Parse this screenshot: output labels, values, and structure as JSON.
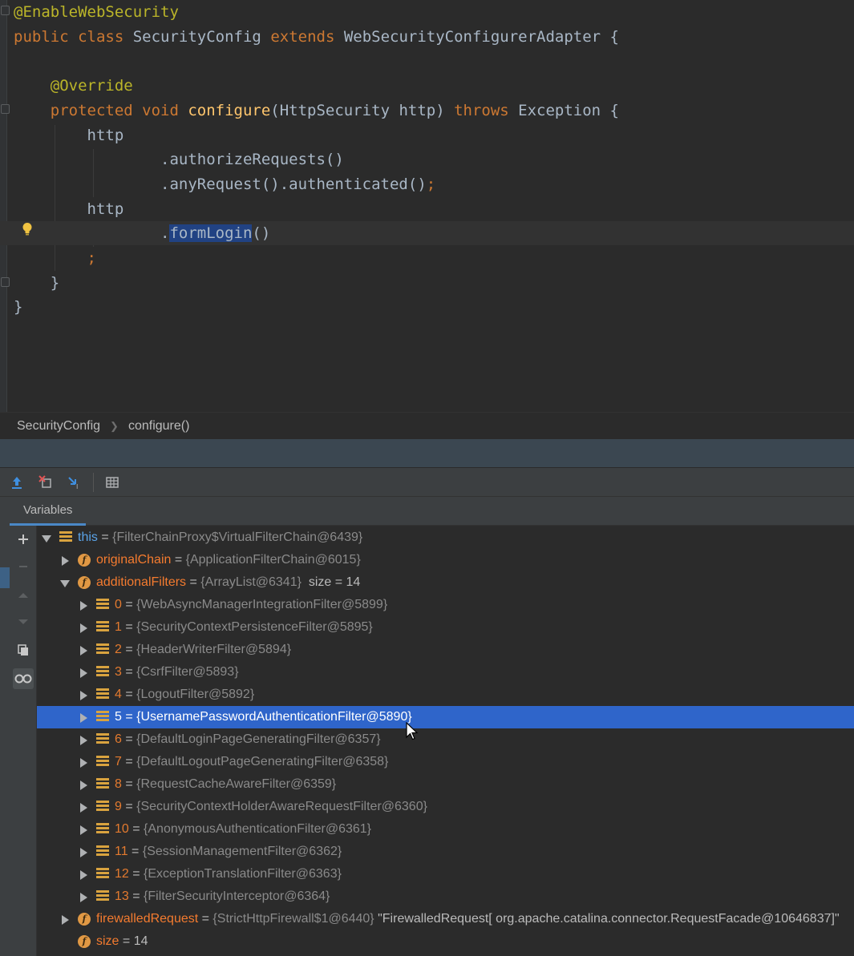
{
  "editor": {
    "lines": [
      [
        {
          "t": "@EnableWebSecurity",
          "c": "a"
        }
      ],
      [
        {
          "t": "public class ",
          "c": "k"
        },
        {
          "t": "SecurityConfig ",
          "c": "n"
        },
        {
          "t": "extends ",
          "c": "k"
        },
        {
          "t": "WebSecurityConfigurerAdapter {",
          "c": "n"
        }
      ],
      [],
      [
        {
          "t": "    @Override",
          "c": "a"
        }
      ],
      [
        {
          "t": "    protected void ",
          "c": "k"
        },
        {
          "t": "configure",
          "c": "f"
        },
        {
          "t": "(HttpSecurity http) ",
          "c": "n"
        },
        {
          "t": "throws ",
          "c": "k"
        },
        {
          "t": "Exception {",
          "c": "n"
        }
      ],
      [
        {
          "t": "        http",
          "c": "n"
        }
      ],
      [
        {
          "t": "                .authorizeRequests()",
          "c": "m"
        }
      ],
      [
        {
          "t": "                .anyRequest().authenticated()",
          "c": "m"
        },
        {
          "t": ";",
          "c": "k"
        }
      ],
      [
        {
          "t": "        http",
          "c": "n"
        }
      ],
      [
        {
          "t": "                .",
          "c": "m"
        },
        {
          "t": "formLogin",
          "c": "m sel"
        },
        {
          "t": "()",
          "c": "m"
        }
      ],
      [
        {
          "t": "        ;",
          "c": "k"
        }
      ],
      [
        {
          "t": "    }",
          "c": "n"
        }
      ],
      [
        {
          "t": "}",
          "c": "n"
        }
      ]
    ],
    "current_line": 9
  },
  "breadcrumb": {
    "items": [
      "SecurityConfig",
      "configure()"
    ]
  },
  "toolbar": {
    "icons": [
      "export-icon",
      "remove-icon",
      "step-icon",
      "table-icon"
    ]
  },
  "tabs": {
    "variables": "Variables"
  },
  "tree": [
    {
      "indent": 0,
      "expander": "down",
      "icon": "list",
      "name": "this",
      "nameClass": "this",
      "value": "{FilterChainProxy$VirtualFilterChain@6439}"
    },
    {
      "indent": 1,
      "expander": "right",
      "icon": "field",
      "name": "originalChain",
      "value": "{ApplicationFilterChain@6015}"
    },
    {
      "indent": 1,
      "expander": "down",
      "icon": "field",
      "name": "additionalFilters",
      "value": "{ArrayList@6341}",
      "extra": "  size = 14"
    },
    {
      "indent": 2,
      "expander": "right",
      "icon": "list",
      "name": "0",
      "nameClass": "idx",
      "value": "{WebAsyncManagerIntegrationFilter@5899}"
    },
    {
      "indent": 2,
      "expander": "right",
      "icon": "list",
      "name": "1",
      "nameClass": "idx",
      "value": "{SecurityContextPersistenceFilter@5895}"
    },
    {
      "indent": 2,
      "expander": "right",
      "icon": "list",
      "name": "2",
      "nameClass": "idx",
      "value": "{HeaderWriterFilter@5894}"
    },
    {
      "indent": 2,
      "expander": "right",
      "icon": "list",
      "name": "3",
      "nameClass": "idx",
      "value": "{CsrfFilter@5893}"
    },
    {
      "indent": 2,
      "expander": "right",
      "icon": "list",
      "name": "4",
      "nameClass": "idx",
      "value": "{LogoutFilter@5892}"
    },
    {
      "indent": 2,
      "expander": "right",
      "icon": "list",
      "name": "5",
      "nameClass": "idx",
      "value": "{UsernamePasswordAuthenticationFilter@5890}",
      "selected": true
    },
    {
      "indent": 2,
      "expander": "right",
      "icon": "list",
      "name": "6",
      "nameClass": "idx",
      "value": "{DefaultLoginPageGeneratingFilter@6357}"
    },
    {
      "indent": 2,
      "expander": "right",
      "icon": "list",
      "name": "7",
      "nameClass": "idx",
      "value": "{DefaultLogoutPageGeneratingFilter@6358}"
    },
    {
      "indent": 2,
      "expander": "right",
      "icon": "list",
      "name": "8",
      "nameClass": "idx",
      "value": "{RequestCacheAwareFilter@6359}"
    },
    {
      "indent": 2,
      "expander": "right",
      "icon": "list",
      "name": "9",
      "nameClass": "idx",
      "value": "{SecurityContextHolderAwareRequestFilter@6360}"
    },
    {
      "indent": 2,
      "expander": "right",
      "icon": "list",
      "name": "10",
      "nameClass": "idx",
      "value": "{AnonymousAuthenticationFilter@6361}"
    },
    {
      "indent": 2,
      "expander": "right",
      "icon": "list",
      "name": "11",
      "nameClass": "idx",
      "value": "{SessionManagementFilter@6362}"
    },
    {
      "indent": 2,
      "expander": "right",
      "icon": "list",
      "name": "12",
      "nameClass": "idx",
      "value": "{ExceptionTranslationFilter@6363}"
    },
    {
      "indent": 2,
      "expander": "right",
      "icon": "list",
      "name": "13",
      "nameClass": "idx",
      "value": "{FilterSecurityInterceptor@6364}"
    },
    {
      "indent": 1,
      "expander": "right",
      "icon": "field",
      "name": "firewalledRequest",
      "value": "{StrictHttpFirewall$1@6440}",
      "extra": " \"FirewalledRequest[ org.apache.catalina.connector.RequestFacade@10646837]\""
    },
    {
      "indent": 1,
      "expander": "none",
      "icon": "field",
      "name": "size",
      "value": "14",
      "valueClass": "plain"
    }
  ],
  "colors": {
    "keyword": "#cc7832",
    "annotation": "#bbb529",
    "method": "#ffc66d",
    "selection": "#2f65ca",
    "variable_name": "#f47b2f"
  }
}
